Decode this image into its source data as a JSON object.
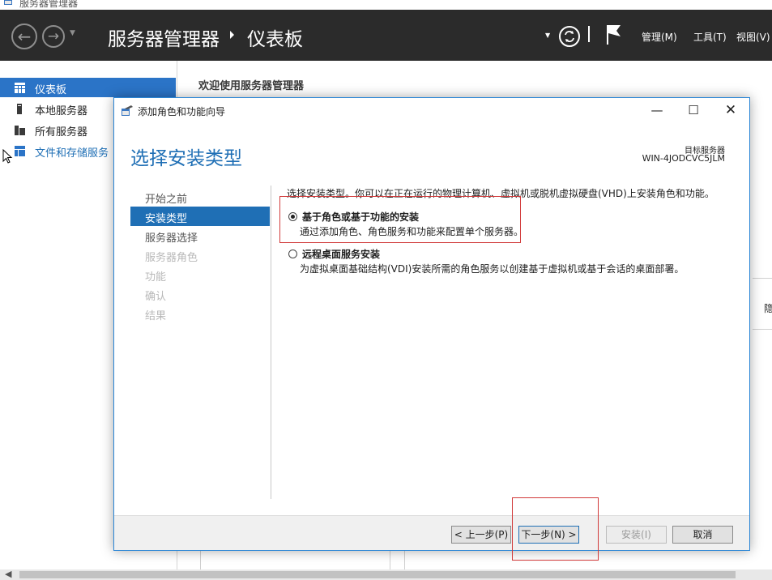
{
  "window": {
    "title": "服务器管理器"
  },
  "header": {
    "breadcrumb_root": "服务器管理器",
    "breadcrumb_current": "仪表板",
    "menu": {
      "manage": "管理(M)",
      "tools": "工具(T)",
      "view": "视图(V)"
    }
  },
  "sidebar": {
    "items": [
      {
        "label": "仪表板",
        "icon": "dashboard-icon",
        "active": true
      },
      {
        "label": "本地服务器",
        "icon": "server-icon"
      },
      {
        "label": "所有服务器",
        "icon": "servers-icon"
      },
      {
        "label": "文件和存储服务",
        "icon": "storage-icon"
      }
    ]
  },
  "main": {
    "welcome": "欢迎使用服务器管理器",
    "side_peek": "隐"
  },
  "dialog": {
    "title": "添加角色和功能向导",
    "heading": "选择安装类型",
    "target_label": "目标服务器",
    "target_name": "WIN-4JODCVC5JLM",
    "steps": [
      {
        "label": "开始之前",
        "state": "normal"
      },
      {
        "label": "安装类型",
        "state": "active"
      },
      {
        "label": "服务器选择",
        "state": "normal"
      },
      {
        "label": "服务器角色",
        "state": "disabled"
      },
      {
        "label": "功能",
        "state": "disabled"
      },
      {
        "label": "确认",
        "state": "disabled"
      },
      {
        "label": "结果",
        "state": "disabled"
      }
    ],
    "instruction": "选择安装类型。你可以在正在运行的物理计算机、虚拟机或脱机虚拟硬盘(VHD)上安装角色和功能。",
    "options": [
      {
        "title": "基于角色或基于功能的安装",
        "desc": "通过添加角色、角色服务和功能来配置单个服务器。",
        "selected": true
      },
      {
        "title": "远程桌面服务安装",
        "desc": "为虚拟桌面基础结构(VDI)安装所需的角色服务以创建基于虚拟机或基于会话的桌面部署。",
        "selected": false
      }
    ],
    "buttons": {
      "prev": "< 上一步(P)",
      "next": "下一步(N) >",
      "install": "安装(I)",
      "cancel": "取消"
    }
  },
  "colors": {
    "accent": "#1f6fb5",
    "header_bg": "#2b2b2b",
    "highlight": "#d13a3a"
  }
}
